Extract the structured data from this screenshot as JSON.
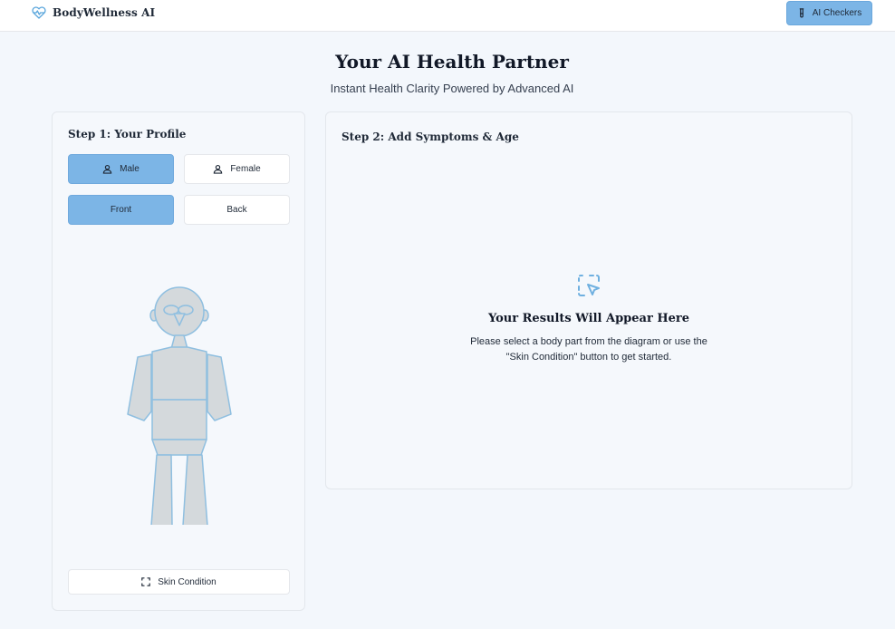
{
  "header": {
    "brand_name": "BodyWellness AI",
    "brand_icon": "heart-pulse-icon",
    "ai_checkers_label": "AI Checkers",
    "ai_checkers_icon": "test-tube-icon"
  },
  "hero": {
    "title": "Your AI Health Partner",
    "subtitle": "Instant Health Clarity Powered by Advanced AI"
  },
  "profile": {
    "step_title": "Step 1: Your Profile",
    "gender_options": [
      {
        "label": "Male",
        "icon": "user-icon",
        "selected": true
      },
      {
        "label": "Female",
        "icon": "user-icon",
        "selected": false
      }
    ],
    "view_options": [
      {
        "label": "Front",
        "selected": true
      },
      {
        "label": "Back",
        "selected": false
      }
    ],
    "skin_condition_label": "Skin Condition",
    "skin_condition_icon": "scan-icon"
  },
  "symptoms": {
    "step_title": "Step 2: Add Symptoms & Age",
    "results_icon": "pointer-select-icon",
    "results_title": "Your Results Will Appear Here",
    "results_line1": "Please select a body part from the diagram or use the",
    "results_line2": "\"Skin Condition\" button to get started."
  },
  "colors": {
    "accent": "#7cb5e6",
    "body_fill": "#d4d9dc",
    "body_stroke": "#8fbfe0",
    "background": "#f3f7fc"
  }
}
